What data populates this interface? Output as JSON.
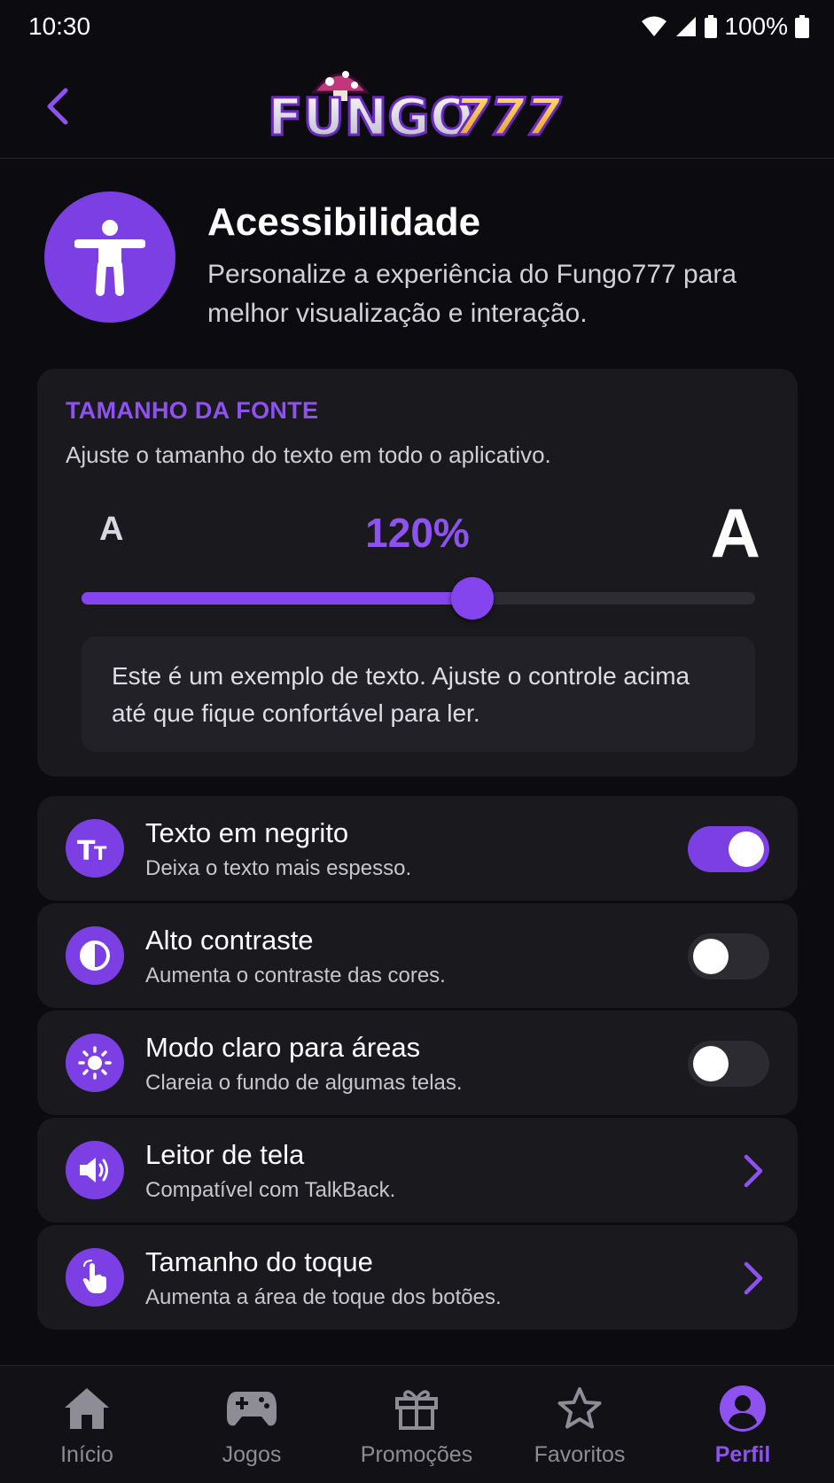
{
  "status_bar": {
    "time": "10:30",
    "battery": "100%"
  },
  "header": {
    "back_icon": "chevron-left-icon",
    "logo_text_left": "FUNGO",
    "logo_text_right": "777"
  },
  "hero": {
    "icon": "accessibility-person-icon",
    "title": "Acessibilidade",
    "description": "Personalize a experiência do Fungo777 para melhor visualização e interação."
  },
  "font_size": {
    "title": "TAMANHO DA FONTE",
    "description": "Ajuste o tamanho do texto em todo o aplicativo.",
    "label_small": "A",
    "label_large": "A",
    "value_label": "120%",
    "slider_fraction": 0.58,
    "sample_text": "Este é um exemplo de texto. Ajuste o controle acima até que fique confortável para ler."
  },
  "options": [
    {
      "icon": "text-size-icon",
      "title": "Texto em negrito",
      "subtitle": "Deixa o texto mais espesso.",
      "control": "toggle",
      "enabled": true
    },
    {
      "icon": "contrast-icon",
      "title": "Alto contraste",
      "subtitle": "Aumenta o contraste das cores.",
      "control": "toggle",
      "enabled": false
    },
    {
      "icon": "sun-icon",
      "title": "Modo claro para áreas",
      "subtitle": "Clareia o fundo de algumas telas.",
      "control": "toggle",
      "enabled": false
    },
    {
      "icon": "speaker-icon",
      "title": "Leitor de tela",
      "subtitle": "Compatível com TalkBack.",
      "control": "chevron"
    },
    {
      "icon": "touch-hand-icon",
      "title": "Tamanho do toque",
      "subtitle": "Aumenta a área de toque dos botões.",
      "control": "chevron"
    }
  ],
  "bottom_nav": [
    {
      "icon": "home-icon",
      "label": "Início",
      "active": false
    },
    {
      "icon": "gamepad-icon",
      "label": "Jogos",
      "active": false
    },
    {
      "icon": "gift-icon",
      "label": "Promoções",
      "active": false
    },
    {
      "icon": "star-icon",
      "label": "Favoritos",
      "active": false
    },
    {
      "icon": "profile-icon",
      "label": "Perfil",
      "active": true
    }
  ],
  "colors": {
    "accent": "#7b3fe4",
    "accent_text": "#8e52f0",
    "background": "#0c0b0f",
    "card": "#1a191e"
  }
}
